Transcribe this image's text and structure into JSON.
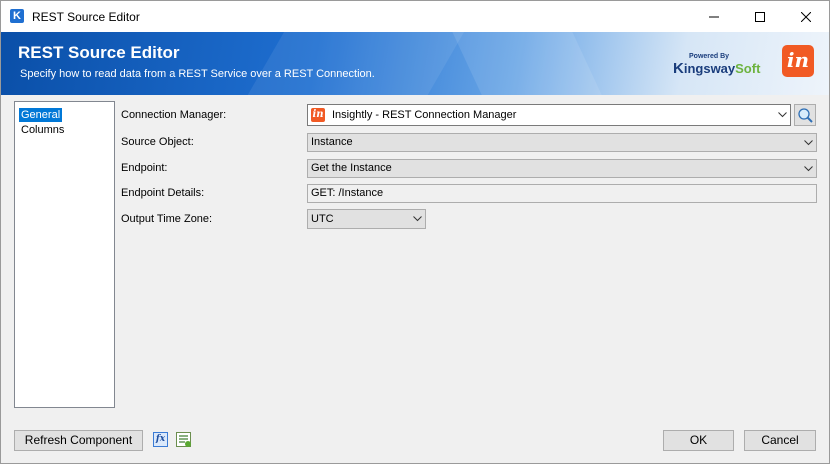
{
  "window": {
    "title": "REST Source Editor"
  },
  "banner": {
    "title": "REST Source Editor",
    "subtitle": "Specify how to read data from a REST Service over a REST Connection.",
    "vendor_powered": "Powered By",
    "vendor_k": "K",
    "vendor_ingsway": "ingsway",
    "vendor_soft": "Soft",
    "service_logo": "in"
  },
  "nav": {
    "items": [
      {
        "label": "General",
        "selected": true
      },
      {
        "label": "Columns",
        "selected": false
      }
    ]
  },
  "form": {
    "connection_manager": {
      "label": "Connection Manager:",
      "value": "Insightly - REST Connection Manager",
      "icon": "in"
    },
    "source_object": {
      "label": "Source Object:",
      "value": "Instance"
    },
    "endpoint": {
      "label": "Endpoint:",
      "value": "Get the Instance"
    },
    "endpoint_details": {
      "label": "Endpoint Details:",
      "value": "GET: /Instance"
    },
    "output_time_zone": {
      "label": "Output Time Zone:",
      "value": "UTC"
    }
  },
  "footer": {
    "refresh_label": "Refresh Component",
    "fx_label": "fx",
    "ok_label": "OK",
    "cancel_label": "Cancel"
  },
  "colors": {
    "selection": "#0078d7",
    "banner_blue": "#1f6fd1",
    "insightly_orange": "#f15a24"
  }
}
